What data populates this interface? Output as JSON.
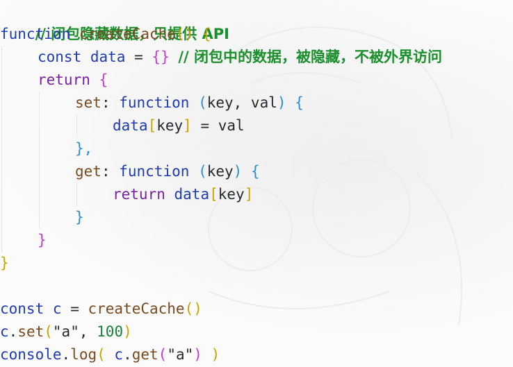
{
  "code": {
    "l1": {
      "comment": "// 闭包隐藏数据，只提供 API"
    },
    "l2": {
      "kw": "function",
      "fn": "createCache",
      "paren": "()",
      "brace": "{"
    },
    "l3": {
      "kw": "const",
      "var": "data",
      "eq": "=",
      "obj": "{}",
      "comment": "// 闭包中的数据，被隐藏，不被外界访问"
    },
    "l4": {
      "kw": "return",
      "brace": "{"
    },
    "l5": {
      "prop": "set",
      "colon": ":",
      "kw": "function",
      "open": "(",
      "params": "key, val",
      "close": ")",
      "brace": "{"
    },
    "l6": {
      "obj": "data",
      "open": "[",
      "key": "key",
      "close": "]",
      "rest": "= val"
    },
    "l7": {
      "text": "},"
    },
    "l8": {
      "prop": "get",
      "colon": ":",
      "kw": "function",
      "open": "(",
      "params": "key",
      "close": ")",
      "brace": "{"
    },
    "l9": {
      "kw": "return",
      "obj": "data",
      "open": "[",
      "key": "key",
      "close": "]"
    },
    "l10": {
      "text": "}"
    },
    "l11": {
      "text": "}"
    },
    "l12": {
      "text": "}"
    },
    "l14": {
      "kw": "const",
      "var": "c",
      "eq": "=",
      "fn": "createCache",
      "paren": "()"
    },
    "l15": {
      "obj": "c",
      "dot": ".",
      "fn": "set",
      "open": "(",
      "str": "\"a\"",
      "comma": ",",
      "num": "100",
      "close": ")"
    },
    "l16": {
      "obj": "console",
      "dot": ".",
      "fn": "log",
      "open": "(",
      "obj2": "c",
      "dot2": ".",
      "fn2": "get",
      "open2": "(",
      "str": "\"a\"",
      "close2": ")",
      "close": ")"
    }
  },
  "colors": {
    "keyword": "#1f3bb3",
    "keyword_purple": "#7a1fa2",
    "function_name": "#7a4a1f",
    "comment": "#1a8f2b",
    "bracket_yellow": "#c9a400",
    "bracket_pink": "#c03bd0",
    "bracket_blue": "#2f8ccf",
    "number": "#1b7f3b"
  }
}
